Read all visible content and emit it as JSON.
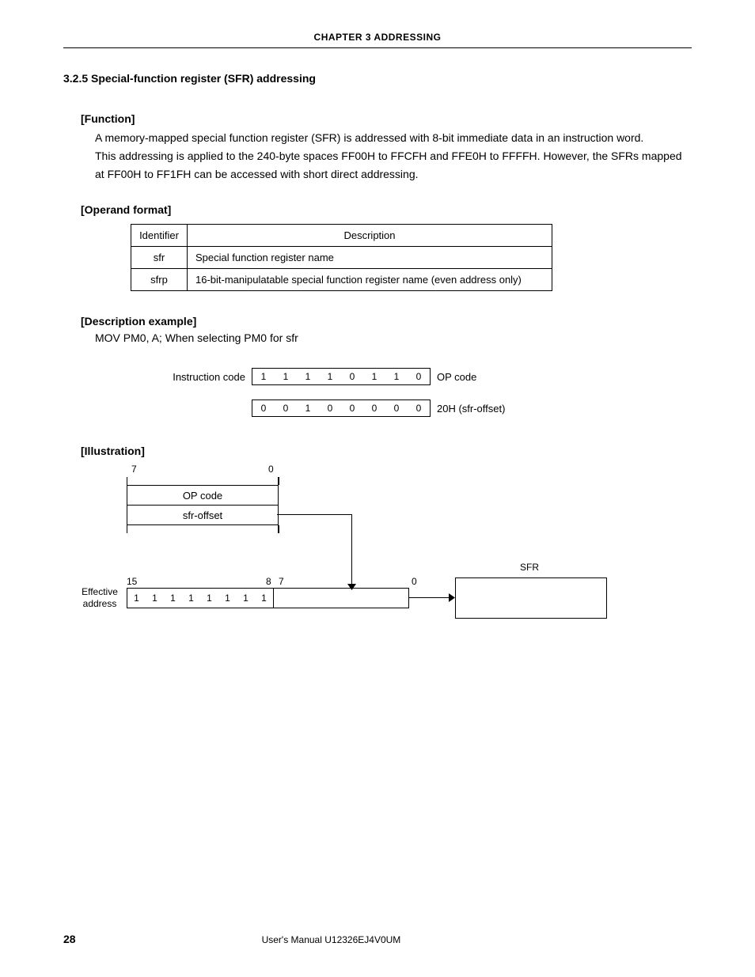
{
  "chapter_header": "CHAPTER 3  ADDRESSING",
  "section_title": "3.2.5  Special-function register (SFR) addressing",
  "function": {
    "label": "[Function]",
    "text": "A memory-mapped special function register (SFR) is addressed with 8-bit immediate data in an instruction word.\nThis addressing is applied to the 240-byte spaces FF00H to FFCFH and FFE0H to FFFFH.  However, the SFRs mapped at FF00H to FF1FH can be accessed with short direct addressing."
  },
  "operand": {
    "label": "[Operand format]",
    "headers": {
      "id": "Identifier",
      "desc": "Description"
    },
    "rows": [
      {
        "id": "sfr",
        "desc": "Special function register name"
      },
      {
        "id": "sfrp",
        "desc": "16-bit-manipulatable special function register name (even address only)"
      }
    ]
  },
  "description_example": {
    "label": "[Description example]",
    "text": "MOV PM0, A; When selecting PM0 for sfr"
  },
  "instruction": {
    "label": "Instruction code",
    "row1": {
      "bits": [
        "1",
        "1",
        "1",
        "1",
        "0",
        "1",
        "1",
        "0"
      ],
      "caption": "OP code"
    },
    "row2": {
      "bits": [
        "0",
        "0",
        "1",
        "0",
        "0",
        "0",
        "0",
        "0"
      ],
      "caption": "20H (sfr-offset)"
    }
  },
  "illustration": {
    "label": "[Illustration]",
    "top_left_tick": "7",
    "top_right_tick": "0",
    "box_row1": "OP code",
    "box_row2": "sfr-offset",
    "sfr_label": "SFR",
    "mid_left": "15",
    "mid_mid1": "8",
    "mid_mid2": "7",
    "mid_right": "0",
    "effective_label": "Effective address",
    "eff_bits": [
      "1",
      "1",
      "1",
      "1",
      "1",
      "1",
      "1",
      "1"
    ]
  },
  "footer": {
    "page": "28",
    "text": "User's Manual  U12326EJ4V0UM"
  }
}
